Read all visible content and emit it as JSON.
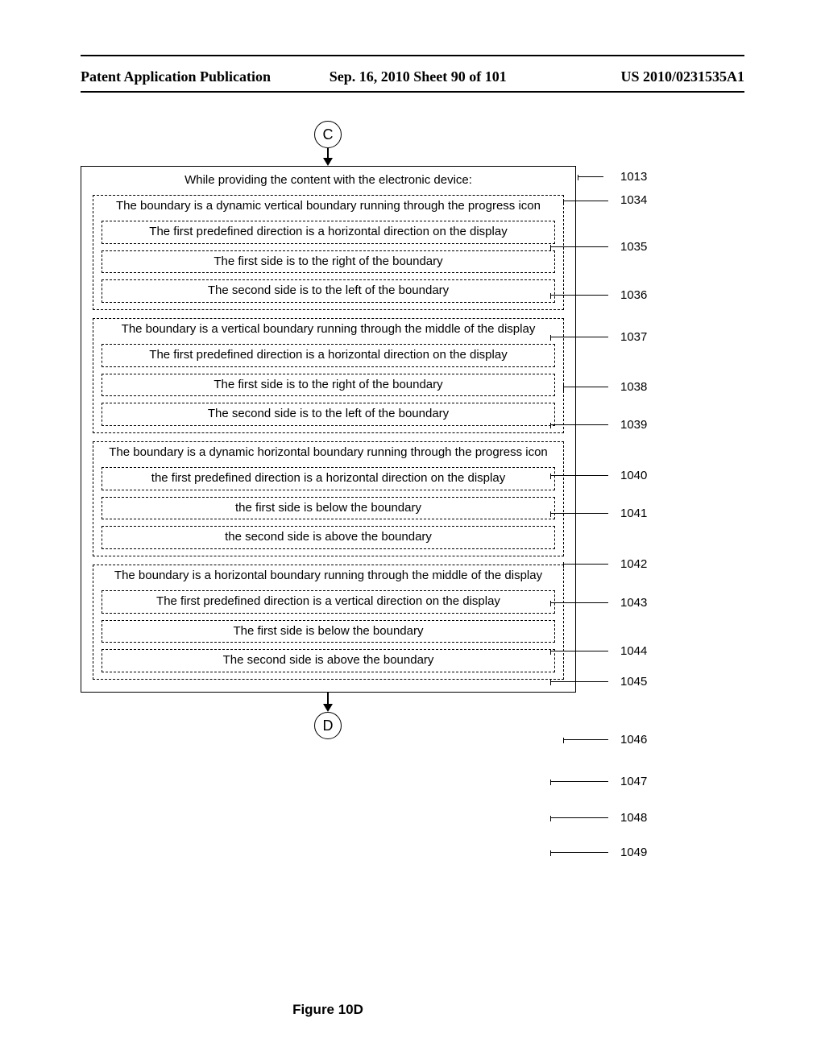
{
  "header": {
    "left": "Patent Application Publication",
    "center": "Sep. 16, 2010  Sheet 90 of 101",
    "right": "US 2010/0231535A1"
  },
  "connectors": {
    "top": "C",
    "bottom": "D"
  },
  "main": {
    "title": "While providing the content with the electronic device:",
    "groups": [
      {
        "outer": "The boundary is a dynamic vertical boundary running through the progress icon",
        "inners": [
          "The first predefined direction is a horizontal direction on the display",
          "The first side is to the right of the boundary",
          "The second side is to the left of the boundary"
        ]
      },
      {
        "outer": "The boundary is a vertical boundary running through the middle of the display",
        "inners": [
          "The first predefined direction is a horizontal direction on the display",
          "The first side is to the right of the boundary",
          "The second side is to the left of the boundary"
        ]
      },
      {
        "outer": "The boundary is a dynamic  horizontal boundary running through the progress icon",
        "inners": [
          "the first predefined direction is a horizontal direction on the display",
          "the first side is below the boundary",
          "the second side is above the boundary"
        ]
      },
      {
        "outer": "The boundary is a horizontal boundary running through the middle of the display",
        "inners": [
          "The first predefined direction is a vertical direction on the display",
          "The first side is below the boundary",
          "The second side is above the boundary"
        ]
      }
    ]
  },
  "refs": {
    "r1013": "1013",
    "r1034": "1034",
    "r1035": "1035",
    "r1036": "1036",
    "r1037": "1037",
    "r1038": "1038",
    "r1039": "1039",
    "r1040": "1040",
    "r1041": "1041",
    "r1042": "1042",
    "r1043": "1043",
    "r1044": "1044",
    "r1045": "1045",
    "r1046": "1046",
    "r1047": "1047",
    "r1048": "1048",
    "r1049": "1049"
  },
  "figure": "Figure 10D"
}
